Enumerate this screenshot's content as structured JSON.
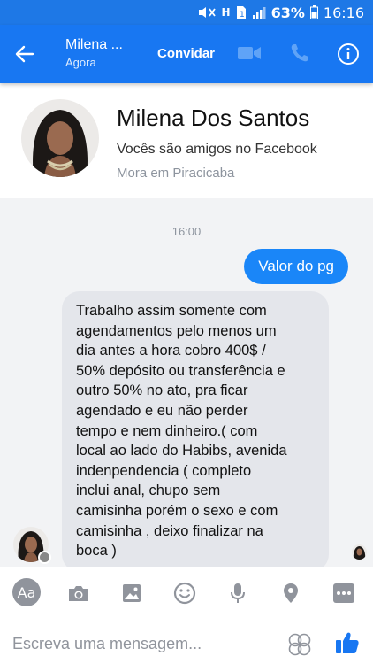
{
  "status_bar": {
    "battery": "63%",
    "time": "16:16",
    "network": "H"
  },
  "header": {
    "contact_name": "Milena ...",
    "contact_status": "Agora",
    "invite_label": "Convidar"
  },
  "profile": {
    "name": "Milena Dos Santos",
    "friends_text": "Vocês são amigos no Facebook",
    "location_text": "Mora em Piracicaba"
  },
  "conversation": {
    "timestamp": "16:00",
    "messages": [
      {
        "from": "me",
        "text": "Valor do pg"
      },
      {
        "from": "contact",
        "text": "Trabalho assim somente com\nagendamentos  pelo menos um\ndia antes  a hora cobro 400$ /\n50% depósito ou transferência e\noutro 50% no ato, pra ficar\nagendado e eu não perder\ntempo e nem dinheiro.( com\nlocal ao lado do Habibs, avenida\nindenpendencia ( completo\ninclui anal, chupo sem\ncamisinha porém o sexo e com\ncamisinha , deixo finalizar na\nboca )"
      }
    ]
  },
  "composer": {
    "aa_label": "Aa",
    "placeholder": "Escreva uma mensagem...",
    "tools": [
      "camera-icon",
      "gallery-icon",
      "emoji-icon",
      "microphone-icon",
      "location-icon",
      "more-icon"
    ]
  },
  "colors": {
    "header_blue": "#1877f2",
    "outgoing_bubble": "#1a86f8",
    "incoming_bubble": "#e4e6eb"
  }
}
